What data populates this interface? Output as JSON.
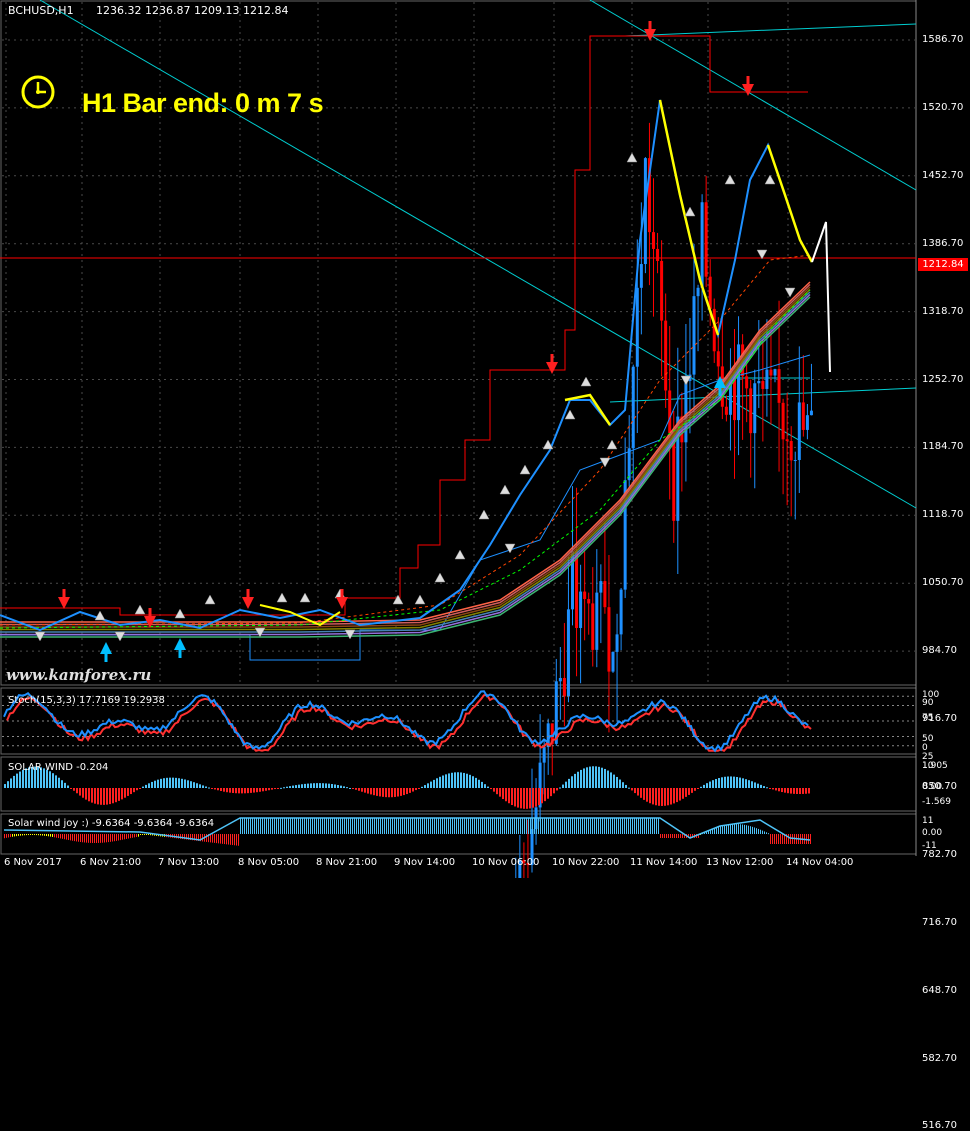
{
  "header": {
    "symbol_timeframe": "BCHUSD,H1",
    "ohlc": "1236.32 1236.87 1209.13 1212.84"
  },
  "overlay": {
    "bar_end_text": "H1 Bar end: 0 m 7 s",
    "watermark": "www.kamforex.ru",
    "clock_icon": "clock-icon"
  },
  "price_axis": {
    "ticks": [
      "1586.70",
      "1520.70",
      "1452.70",
      "1386.70",
      "1318.70",
      "1252.70",
      "1184.70",
      "1118.70",
      "1050.70",
      "984.70",
      "916.70",
      "850.70",
      "782.70",
      "716.70",
      "648.70",
      "582.70",
      "516.70"
    ],
    "current_price": "1212.84"
  },
  "time_axis": {
    "ticks": [
      "6 Nov 2017",
      "6 Nov 21:00",
      "7 Nov 13:00",
      "8 Nov 05:00",
      "8 Nov 21:00",
      "9 Nov 14:00",
      "10 Nov 06:00",
      "10 Nov 22:00",
      "11 Nov 14:00",
      "13 Nov 12:00",
      "14 Nov 04:00"
    ]
  },
  "stoch_panel": {
    "label": "Stoch(15,3,3) 17.7169 19.2938",
    "levels": [
      "100",
      "90",
      "75",
      "50",
      "25",
      "10",
      "0"
    ]
  },
  "solar_panel": {
    "label": "SOLAR WIND -0.204",
    "levels": [
      "1.905",
      "0.00",
      "-1.569"
    ]
  },
  "joy_panel": {
    "label": "Solar wind joy :) -9.6364 -9.6364 -9.6364",
    "levels": [
      "11",
      "0.00",
      "-11"
    ]
  },
  "colors": {
    "background": "#000000",
    "up_candle": "#1e90ff",
    "down_candle": "#ff0000",
    "grid": "#4a4a4a",
    "trendline": "#00ced1",
    "ma_fast": "#ffff00",
    "channel": "#ff0000"
  }
}
